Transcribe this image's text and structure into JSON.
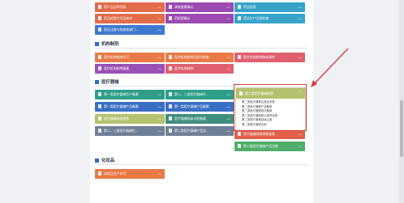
{
  "sections": {
    "institution": "机构制剂",
    "device": "医疗器械",
    "cosmetics": "化妆品"
  },
  "top_tiles": [
    {
      "label": "药产品品种列表",
      "color": "#e26b4a"
    },
    {
      "label": "调查备案确认",
      "color": "#9a4ab0"
    },
    {
      "label": "药品信息",
      "color": "#36a3c9"
    },
    {
      "label": "药品经营许可证核对",
      "color": "#e26b4a"
    },
    {
      "label": "药经营确认",
      "color": "#9a4ab0"
    },
    {
      "label": "药品生产全程检查",
      "color": "#36a3c9"
    },
    {
      "label": "药品注册与检查核查门...",
      "color": "#3f78d0"
    }
  ],
  "institution_tiles": [
    {
      "label": "医疗机构制剂许可",
      "color": "#e97a48"
    },
    {
      "label": "医疗机构制剂注册与检查",
      "color": "#e97a48"
    },
    {
      "label": "医疗机构制剂跨省调剂",
      "color": "#e06070"
    },
    {
      "label": "医疗机构制剂备案",
      "color": "#9a50b6"
    },
    {
      "label": "医疗机构制剂",
      "color": "#e06070"
    }
  ],
  "device_tiles": [
    {
      "label": "第一类医疗器械生产备案",
      "color": "#2e9e8a"
    },
    {
      "label": "第二、三类医疗器械生...",
      "color": "#2e9e8a"
    },
    {
      "label": "第一类医疗器械产品备案",
      "color": "#3b6fc4"
    },
    {
      "label": "第一类医疗器械产品备案",
      "color": "#3b6fc4"
    },
    {
      "label": "医疗器械网络销售",
      "color": "#b4c26e"
    },
    {
      "label": "医疗器械临床试验备案",
      "color": "#3f8f7f"
    },
    {
      "label": "第二、三类医疗器械生...",
      "color": "#6f7f96"
    },
    {
      "label": "第二类医疗器械产品注...",
      "color": "#6f7f96"
    },
    {
      "label": "第二类医疗器械产品注册",
      "color": "#4fae6a"
    },
    {
      "label": "医疗器械网络销售备案",
      "color": "#e0604a"
    }
  ],
  "dropdown": {
    "title": "第二类医疗器械变更",
    "items": [
      "第二类医疗器械注册证变更",
      "第二类医疗器械产品备案",
      "第二类医疗器械首次备案",
      "第二类医疗器械登记事项变更",
      "第二类医疗器械延续注册",
      "第二类医疗器械注销"
    ]
  },
  "cosmetics_tiles": [
    {
      "label": "化妆品生产许可",
      "color": "#e97a48"
    }
  ],
  "icons": {
    "chevron": "chevron-up-icon",
    "doc": "document-icon"
  }
}
